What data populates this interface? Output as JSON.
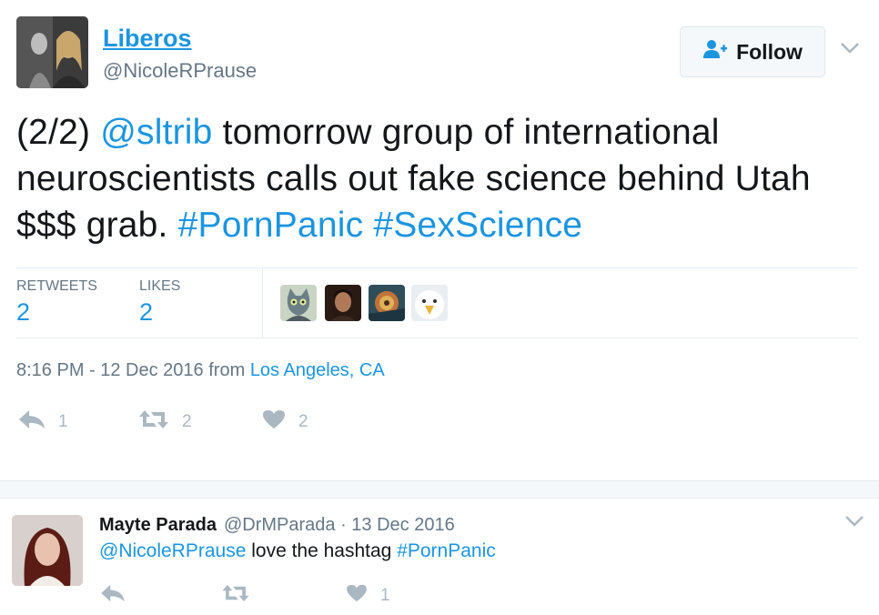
{
  "tweet": {
    "author": {
      "display_name": "Liberos",
      "handle": "@NicoleRPrause"
    },
    "follow_label": "Follow",
    "text_segments": [
      {
        "text": "(2/2) ",
        "type": "plain"
      },
      {
        "text": "@sltrib",
        "type": "mention"
      },
      {
        "text": " tomorrow group of international neuroscientists calls out fake science behind Utah $$$ grab. ",
        "type": "plain"
      },
      {
        "text": "#PornPanic",
        "type": "hashtag"
      },
      {
        "text": " ",
        "type": "plain"
      },
      {
        "text": "#SexScience",
        "type": "hashtag"
      }
    ],
    "stats": {
      "retweets_label": "RETWEETS",
      "retweets": "2",
      "likes_label": "LIKES",
      "likes": "2"
    },
    "likers": [
      "cat-avatar",
      "man-avatar",
      "colorful-art-avatar",
      "eagle-avatar"
    ],
    "timestamp": {
      "time": "8:16 PM - 12 Dec 2016",
      "from": " from ",
      "location": "Los Angeles, CA"
    },
    "actions": {
      "reply_count": "1",
      "retweet_count": "2",
      "like_count": "2"
    }
  },
  "reply": {
    "display_name": "Mayte Parada",
    "meta": "@DrMParada · 13 Dec 2016",
    "mention": "@NicoleRPrause",
    "text": " love the hashtag ",
    "hashtag": "#PornPanic",
    "like_count": "1"
  },
  "colors": {
    "accent": "#1b95e0",
    "muted": "#657786",
    "icon": "#aab8c2"
  }
}
